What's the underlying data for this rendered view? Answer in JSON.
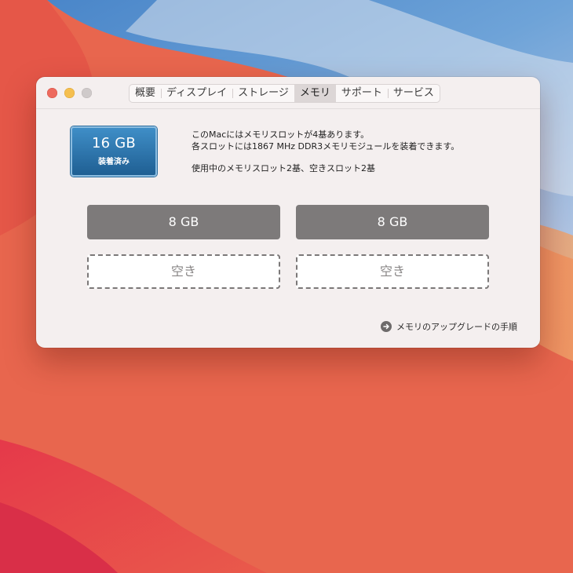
{
  "window": {
    "tabs": [
      {
        "label": "概要"
      },
      {
        "label": "ディスプレイ"
      },
      {
        "label": "ストレージ"
      },
      {
        "label": "メモリ",
        "active": true
      },
      {
        "label": "サポート"
      },
      {
        "label": "サービス"
      }
    ]
  },
  "memory": {
    "badge_size": "16 GB",
    "badge_status": "装着済み",
    "info_line1": "このMacにはメモリスロットが4基あります。",
    "info_line2": "各スロットには1867 MHz DDR3メモリモジュールを装着できます。",
    "info_line3": "使用中のメモリスロット2基、空きスロット2基",
    "slots": [
      {
        "label": "8 GB",
        "state": "filled"
      },
      {
        "label": "8 GB",
        "state": "filled"
      },
      {
        "label": "空き",
        "state": "empty"
      },
      {
        "label": "空き",
        "state": "empty"
      }
    ],
    "upgrade_link": "メモリのアップグレードの手順",
    "upgrade_icon": "arrow-right-circle-icon"
  },
  "colors": {
    "badge_top": "#3f8ec7",
    "badge_bottom": "#1f5f93",
    "slot_filled": "#7d7a7a",
    "close": "#ed6a5e",
    "minimize": "#f5bf4f",
    "zoom_disabled": "#cfcaca"
  }
}
